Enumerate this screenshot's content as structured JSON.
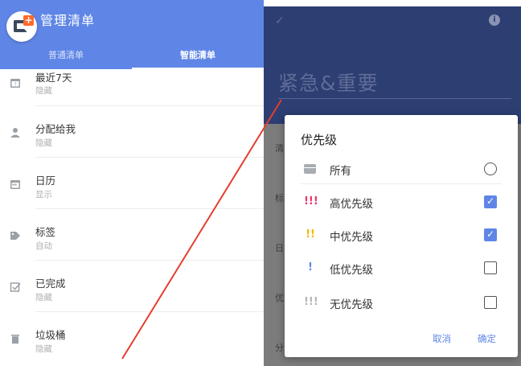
{
  "left": {
    "title": "管理清单",
    "tabs": [
      {
        "label": "普通清单"
      },
      {
        "label": "智能清单"
      }
    ],
    "items": [
      {
        "title": "最近7天",
        "sub": "隐藏",
        "icon": "calendar-7-icon"
      },
      {
        "title": "分配给我",
        "sub": "隐藏",
        "icon": "person-icon"
      },
      {
        "title": "日历",
        "sub": "显示",
        "icon": "calendar-icon"
      },
      {
        "title": "标签",
        "sub": "自动",
        "icon": "tag-icon"
      },
      {
        "title": "已完成",
        "sub": "隐藏",
        "icon": "check-box-icon"
      },
      {
        "title": "垃圾桶",
        "sub": "隐藏",
        "icon": "trash-icon"
      }
    ]
  },
  "right": {
    "header_title": "紧急&重要",
    "bg_labels": [
      "清",
      "标",
      "日",
      "优",
      "分"
    ],
    "dialog": {
      "title": "优先级",
      "options": [
        {
          "label": "所有",
          "marker": "",
          "control": "radio",
          "checked": false
        },
        {
          "label": "高优先级",
          "marker": "!!!",
          "color": "#e8356a",
          "control": "checkbox",
          "checked": true
        },
        {
          "label": "中优先级",
          "marker": "!!",
          "color": "#f5b800",
          "control": "checkbox",
          "checked": true
        },
        {
          "label": "低优先级",
          "marker": "!",
          "color": "#5f86e6",
          "control": "checkbox",
          "checked": false
        },
        {
          "label": "无优先级",
          "marker": "!!!",
          "color": "#b5b5b5",
          "control": "checkbox",
          "checked": false
        }
      ],
      "cancel_label": "取消",
      "ok_label": "确定",
      "check_mark": "✓"
    }
  },
  "colors": {
    "primary": "#5f86e6",
    "header_dark": "#2d3e73",
    "annotation": "#e53d2f"
  }
}
